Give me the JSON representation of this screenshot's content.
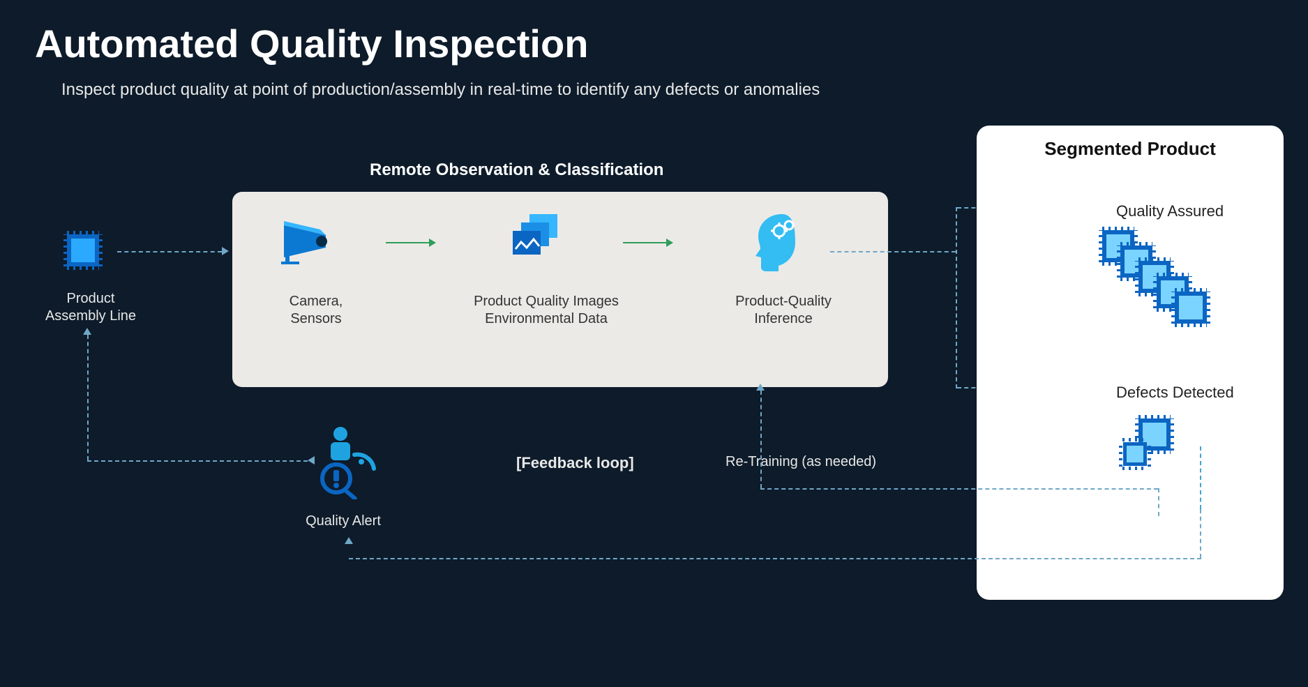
{
  "title": "Automated Quality Inspection",
  "subtitle": "Inspect product quality at point of production/assembly in real-time to identify any defects or anomalies",
  "assembly_line_label": "Product\nAssembly Line",
  "observation": {
    "section_title": "Remote Observation & Classification",
    "camera_label": "Camera,\nSensors",
    "images_label": "Product Quality Images\nEnvironmental Data",
    "inference_label": "Product-Quality\nInference"
  },
  "segmented": {
    "section_title": "Segmented Product",
    "quality_assured_label": "Quality Assured",
    "defects_detected_label": "Defects Detected"
  },
  "quality_alert_label": "Quality Alert",
  "feedback_loop_label": "[Feedback loop]",
  "retraining_label": "Re-Training (as needed)"
}
